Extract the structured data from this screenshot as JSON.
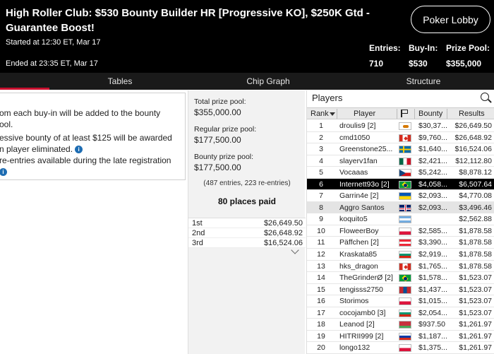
{
  "header": {
    "title": "High Roller Club: $530 Bounty Builder HR [Progressive KO], $250K Gtd - Guarantee Boost!",
    "started": "Started at 12:30 ET, Mar 17",
    "ended": "Ended at 23:35 ET, Mar 17",
    "lobby_button": "Poker Lobby",
    "stats": [
      {
        "label": "Entries:",
        "value": "710"
      },
      {
        "label": "Buy-In:",
        "value": "$530"
      },
      {
        "label": "Prize Pool:",
        "value": "$355,000"
      }
    ]
  },
  "tabs": [
    {
      "label": "Tables"
    },
    {
      "label": "Chip Graph"
    },
    {
      "label": "Structure"
    }
  ],
  "info_lines": [
    "om each buy-in will be added to the bounty",
    "ool.",
    "essive bounty of at least $125 will be awarded",
    "n player eliminated.",
    "re-entries available during the late registration",
    ""
  ],
  "prize": {
    "total_label": "Total prize pool:",
    "total_value": "$355,000.00",
    "regular_label": "Regular prize pool:",
    "regular_value": "$177,500.00",
    "bounty_label": "Bounty prize pool:",
    "bounty_value": "$177,500.00",
    "entries_line": "(487 entries, 223 re-entries)",
    "places_paid": "80 places paid",
    "payouts": [
      {
        "place": "1st",
        "amount": "$26,649.50"
      },
      {
        "place": "2nd",
        "amount": "$26,648.92"
      },
      {
        "place": "3rd",
        "amount": "$16,524.06"
      }
    ]
  },
  "players": {
    "title": "Players",
    "columns": {
      "rank": "Rank",
      "player": "Player",
      "bounty": "Bounty",
      "results": "Results"
    },
    "rows": [
      {
        "rank": "1",
        "name": "droulis9 [2]",
        "flag": "cyprus",
        "bounty": "$30,37...",
        "results": "$26,649.50"
      },
      {
        "rank": "2",
        "name": "cmd1050",
        "flag": "canada",
        "bounty": "$9,760...",
        "results": "$26,648.92"
      },
      {
        "rank": "3",
        "name": "Greenstone25...",
        "flag": "sweden",
        "bounty": "$1,640...",
        "results": "$16,524.06"
      },
      {
        "rank": "4",
        "name": "slayerv1fan",
        "flag": "mexico",
        "bounty": "$2,421...",
        "results": "$12,112.80"
      },
      {
        "rank": "5",
        "name": "Vocaaas",
        "flag": "czech",
        "bounty": "$5,242...",
        "results": "$8,878.12"
      },
      {
        "rank": "6",
        "name": "Internett93o [2]",
        "flag": "brazil",
        "bounty": "$4,058...",
        "results": "$6,507.64"
      },
      {
        "rank": "7",
        "name": "Garrin4e [2]",
        "flag": "ukraine",
        "bounty": "$2,093...",
        "results": "$4,770.08"
      },
      {
        "rank": "8",
        "name": "Aggro Santos",
        "flag": "uk",
        "bounty": "$2,093...",
        "results": "$3,496.46"
      },
      {
        "rank": "9",
        "name": "koquito5",
        "flag": "argentina",
        "bounty": "",
        "results": "$2,562.88"
      },
      {
        "rank": "10",
        "name": "FloweerBoy",
        "flag": "poland",
        "bounty": "$2,585...",
        "results": "$1,878.58"
      },
      {
        "rank": "11",
        "name": "Päffchen [2]",
        "flag": "austria",
        "bounty": "$3,390...",
        "results": "$1,878.58"
      },
      {
        "rank": "12",
        "name": "Kraskata85",
        "flag": "bulgaria",
        "bounty": "$2,919...",
        "results": "$1,878.58"
      },
      {
        "rank": "13",
        "name": "hks_dragon",
        "flag": "canada",
        "bounty": "$1,765...",
        "results": "$1,878.58"
      },
      {
        "rank": "14",
        "name": "TheGrinderØ [2]",
        "flag": "brazil",
        "bounty": "$1,578...",
        "results": "$1,523.07"
      },
      {
        "rank": "15",
        "name": "tengisss2750",
        "flag": "mongolia",
        "bounty": "$1,437...",
        "results": "$1,523.07"
      },
      {
        "rank": "16",
        "name": "Storimos",
        "flag": "poland",
        "bounty": "$1,015...",
        "results": "$1,523.07"
      },
      {
        "rank": "17",
        "name": "cocojamb0 [3]",
        "flag": "bulgaria",
        "bounty": "$2,054...",
        "results": "$1,523.07"
      },
      {
        "rank": "18",
        "name": "Leanod [2]",
        "flag": "belarus",
        "bounty": "$937.50",
        "results": "$1,261.97"
      },
      {
        "rank": "19",
        "name": "HITRII999 [2]",
        "flag": "russia",
        "bounty": "$1,187...",
        "results": "$1,261.97"
      },
      {
        "rank": "20",
        "name": "longo132",
        "flag": "poland",
        "bounty": "$1,375...",
        "results": "$1,261.97"
      }
    ]
  },
  "colors": {
    "header_bg": "#000000",
    "tab_bg": "#1a1a1a",
    "active_tab_accent": "#c8102e",
    "highlight_row": "#000000",
    "info_icon": "#1e6db3"
  }
}
